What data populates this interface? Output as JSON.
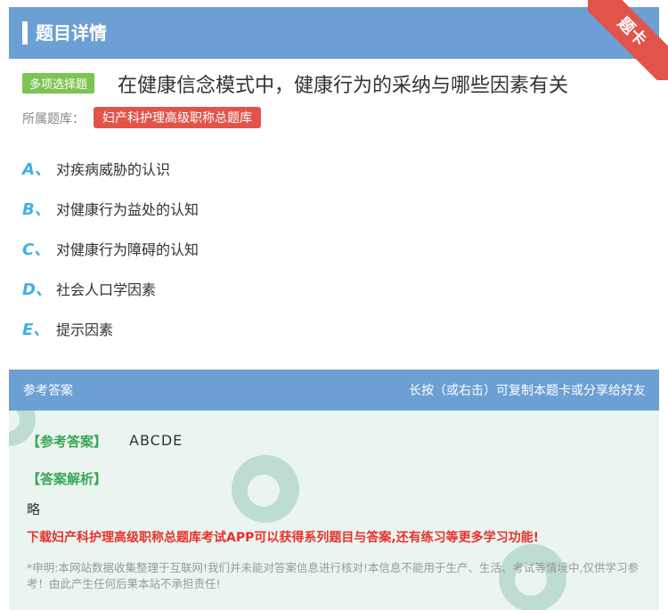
{
  "header": {
    "title": "题目详情"
  },
  "ribbon": {
    "label": "题卡"
  },
  "question": {
    "type_badge": "多项选择题",
    "text": "在健康信念模式中，健康行为的采纳与哪些因素有关"
  },
  "bank": {
    "label": "所属题库：",
    "name": "妇产科护理高级职称总题库"
  },
  "options": [
    {
      "letter": "A、",
      "text": "对疾病威胁的认识"
    },
    {
      "letter": "B、",
      "text": "对健康行为益处的认知"
    },
    {
      "letter": "C、",
      "text": "对健康行为障碍的认知"
    },
    {
      "letter": "D、",
      "text": "社会人口学因素"
    },
    {
      "letter": "E、",
      "text": "提示因素"
    }
  ],
  "answer_section": {
    "title": "参考答案",
    "hint": "长按（或右击）可复制本题卡或分享给好友",
    "answer_label": "【参考答案】",
    "answer_value": "ABCDE",
    "analysis_label": "【答案解析】",
    "analysis_text": "略",
    "promo": "下载妇产科护理高级职称总题库考试APP可以获得系列题目与答案,还有练习等更多学习功能!",
    "disclaimer": "*申明:本网站数据收集整理于互联网!我们并未能对答案信息进行核对!本信息不能用于生产、生活、考试等情境中,仅供学习参考！由此产生任何后果本站不承担责任!"
  },
  "colors": {
    "header_bg": "#6c9fd4",
    "badge_green": "#7ec452",
    "tag_red": "#e2544a",
    "option_letter": "#3fb0e0",
    "answer_green": "#3aa657",
    "promo_red": "#e8312c"
  }
}
